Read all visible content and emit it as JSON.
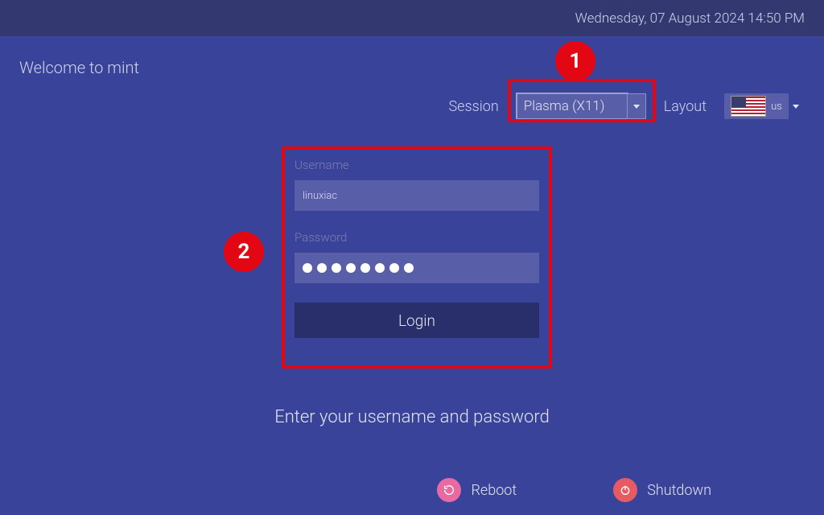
{
  "topbar": {
    "datetime": "Wednesday, 07 August 2024  14:50 PM"
  },
  "welcome": "Welcome to mint",
  "selectors": {
    "session_label": "Session",
    "session_value": "Plasma (X11)",
    "layout_label": "Layout",
    "layout_code": "us"
  },
  "annotations": {
    "badge1": "1",
    "badge2": "2"
  },
  "login": {
    "username_label": "Username",
    "username_value": "linuxiac",
    "password_label": "Password",
    "password_dots": 8,
    "button_label": "Login"
  },
  "prompt": "Enter your username and password",
  "power": {
    "reboot": "Reboot",
    "shutdown": "Shutdown"
  }
}
